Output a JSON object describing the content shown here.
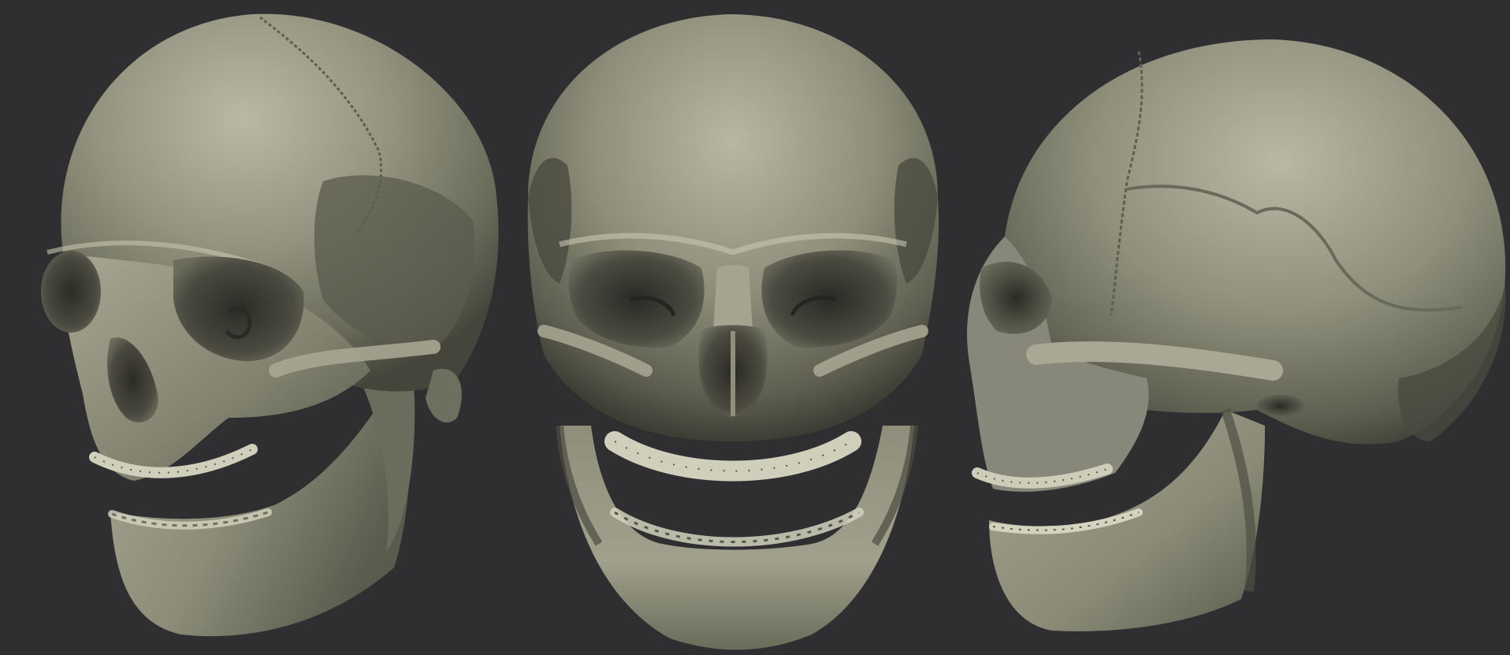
{
  "scene": {
    "background_color": "#2f2f31",
    "material_color": "#8f8f7c",
    "material_highlight": "#c9c9b6",
    "material_shadow": "#3d3d34",
    "views": [
      {
        "id": "three-quarter",
        "subject": "skull-three-quarter-view"
      },
      {
        "id": "front",
        "subject": "skull-front-view"
      },
      {
        "id": "profile",
        "subject": "skull-profile-view"
      }
    ]
  }
}
